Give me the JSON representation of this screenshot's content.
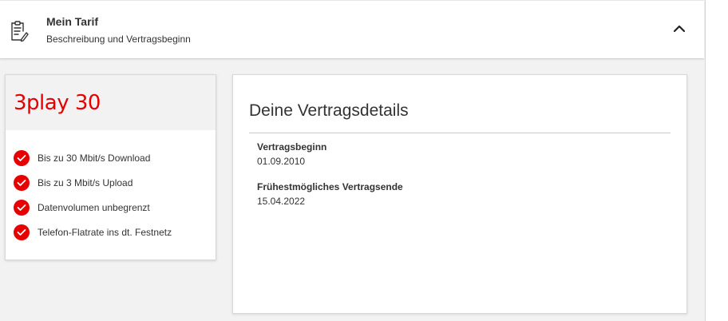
{
  "accordion": {
    "title": "Mein Tarif",
    "subtitle": "Beschreibung und Vertragsbeginn",
    "icon": "document-edit-icon",
    "toggle_icon": "chevron-up-icon"
  },
  "tariff": {
    "name": "3play 30",
    "features": [
      {
        "label": "Bis zu 30 Mbit/s Download"
      },
      {
        "label": "Bis zu 3 Mbit/s Upload"
      },
      {
        "label": "Datenvolumen unbegrenzt"
      },
      {
        "label": "Telefon-Flatrate ins dt. Festnetz"
      }
    ]
  },
  "details": {
    "title": "Deine Vertragsdetails",
    "fields": [
      {
        "label": "Vertragsbeginn",
        "value": "01.09.2010"
      },
      {
        "label": "Frühestmögliches Vertragsende",
        "value": "15.04.2022"
      }
    ]
  },
  "colors": {
    "brand_red": "#e60000",
    "text": "#333333",
    "background": "#f2f2f2"
  }
}
